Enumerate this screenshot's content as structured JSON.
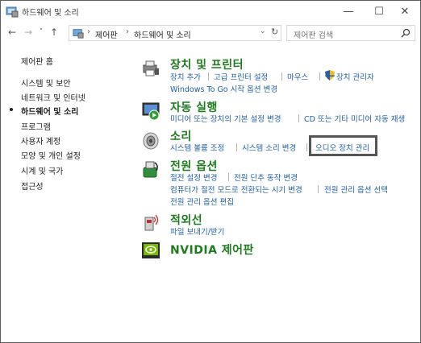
{
  "window": {
    "title": "하드웨어 및 소리",
    "minimize": "—",
    "maximize": "☐",
    "close": "✕"
  },
  "nav": {
    "back": "←",
    "forward": "→",
    "recent": "˅",
    "up": "↑",
    "breadcrumb": [
      "제어판",
      "하드웨어 및 소리"
    ],
    "separator": "›",
    "search_placeholder": "제어판 검색"
  },
  "sidebar": {
    "home": "제어판 홈",
    "items": [
      {
        "label": "시스템 및 보안"
      },
      {
        "label": "네트워크 및 인터넷"
      },
      {
        "label": "하드웨어 및 소리"
      },
      {
        "label": "프로그램"
      },
      {
        "label": "사용자 계정"
      },
      {
        "label": "모양 및 개인 설정"
      },
      {
        "label": "시계 및 국가"
      },
      {
        "label": "접근성"
      }
    ]
  },
  "categories": [
    {
      "title": "장치 및 프린터",
      "icon": "printer-icon",
      "links": [
        "장치 추가",
        "고급 프린터 설정",
        "마우스",
        "장치 관리자",
        "Windows To Go 시작 옵션 변경"
      ]
    },
    {
      "title": "자동 실행",
      "icon": "autoplay-icon",
      "links": [
        "미디어 또는 장치의 기본 설정 변경",
        "CD 또는 기타 미디어 자동 재생"
      ]
    },
    {
      "title": "소리",
      "icon": "speaker-icon",
      "links": [
        "시스템 볼륨 조정",
        "시스템 소리 변경",
        "오디오 장치 관리"
      ]
    },
    {
      "title": "전원 옵션",
      "icon": "power-icon",
      "links": [
        "절전 설정 변경",
        "전원 단추 동작 변경",
        "컴퓨터가 절전 모드로 전환되는 시기 변경",
        "전원 관리 옵션 선택",
        "전원 관리 옵션 편집"
      ]
    },
    {
      "title": "적외선",
      "icon": "infrared-icon",
      "links": [
        "파일 보내기/받기"
      ]
    },
    {
      "title": "NVIDIA 제어판",
      "icon": "nvidia-icon",
      "links": []
    }
  ],
  "colors": {
    "category_title": "#1e7b1e",
    "link": "#1f5fa8",
    "highlight_border": "#555555"
  }
}
